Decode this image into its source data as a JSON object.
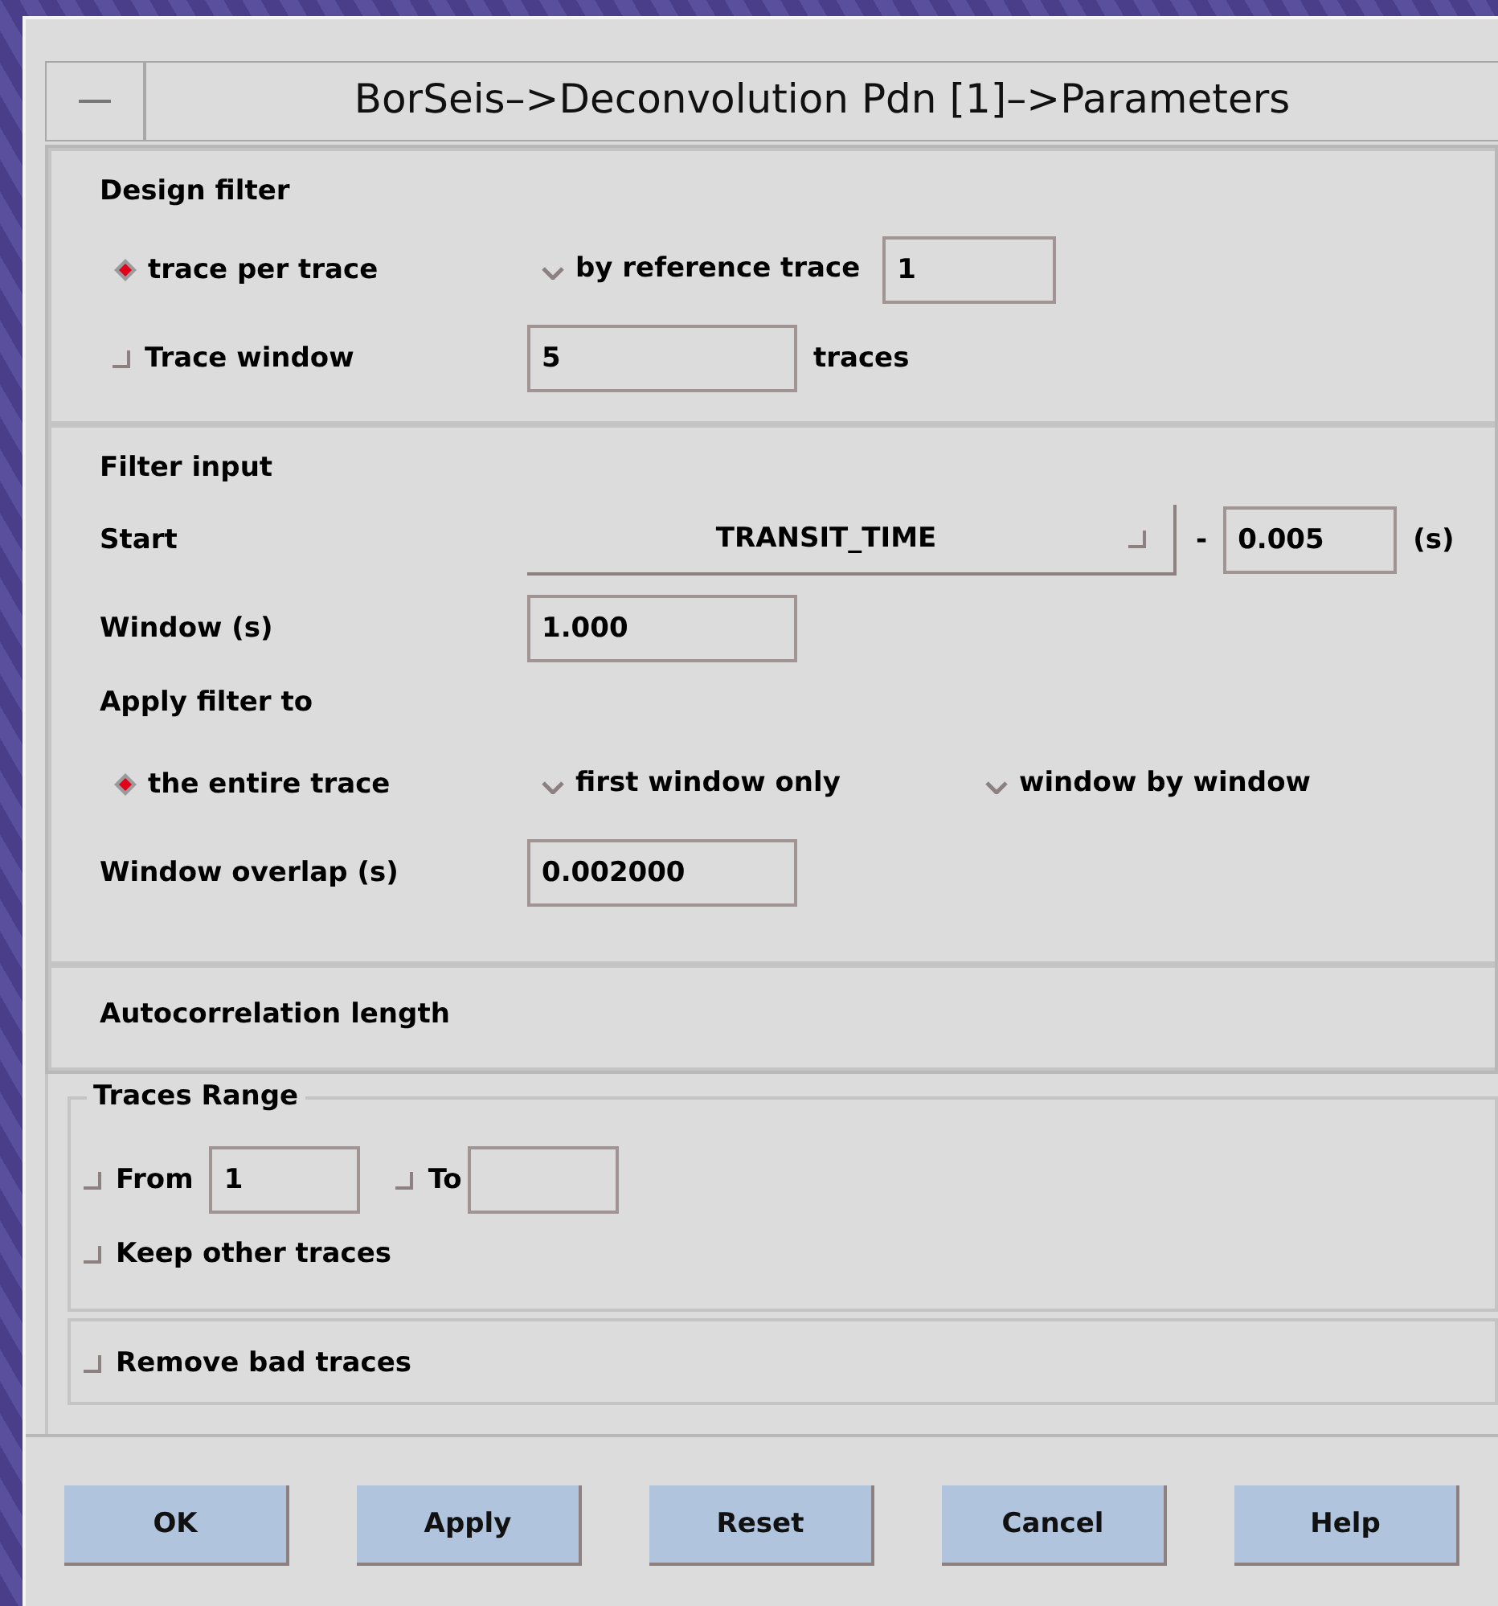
{
  "window": {
    "title": "BorSeis–>Deconvolution Pdn [1]–>Parameters"
  },
  "design_filter": {
    "heading": "Design filter",
    "options": [
      {
        "label": "trace per trace",
        "selected": true
      },
      {
        "label": "by reference trace",
        "selected": false
      }
    ],
    "reference_trace": "1",
    "trace_window": {
      "label": "Trace window",
      "checked": false,
      "value": "5",
      "unit": "traces"
    }
  },
  "filter_input": {
    "heading": "Filter input",
    "start": {
      "label": "Start",
      "dropdown": "TRANSIT_TIME",
      "sign": "-",
      "value": "0.005",
      "unit": "(s)"
    },
    "window": {
      "label": "Window (s)",
      "value": "1.000"
    },
    "apply_heading": "Apply filter to",
    "apply_options": [
      {
        "label": "the entire trace",
        "selected": true
      },
      {
        "label": "first window only",
        "selected": false
      },
      {
        "label": "window by window",
        "selected": false
      }
    ],
    "overlap": {
      "label": "Window overlap (s)",
      "value": "0.002000"
    }
  },
  "autocorrelation": {
    "label": "Autocorrelation length"
  },
  "traces_range": {
    "title": "Traces Range",
    "from": {
      "label": "From",
      "checked": false,
      "value": "1"
    },
    "to": {
      "label": "To",
      "checked": false
    },
    "keep_other": {
      "label": "Keep other traces",
      "checked": false
    }
  },
  "remove_bad": {
    "label": "Remove bad traces",
    "checked": false
  },
  "buttons": [
    "OK",
    "Apply",
    "Reset",
    "Cancel",
    "Help"
  ]
}
